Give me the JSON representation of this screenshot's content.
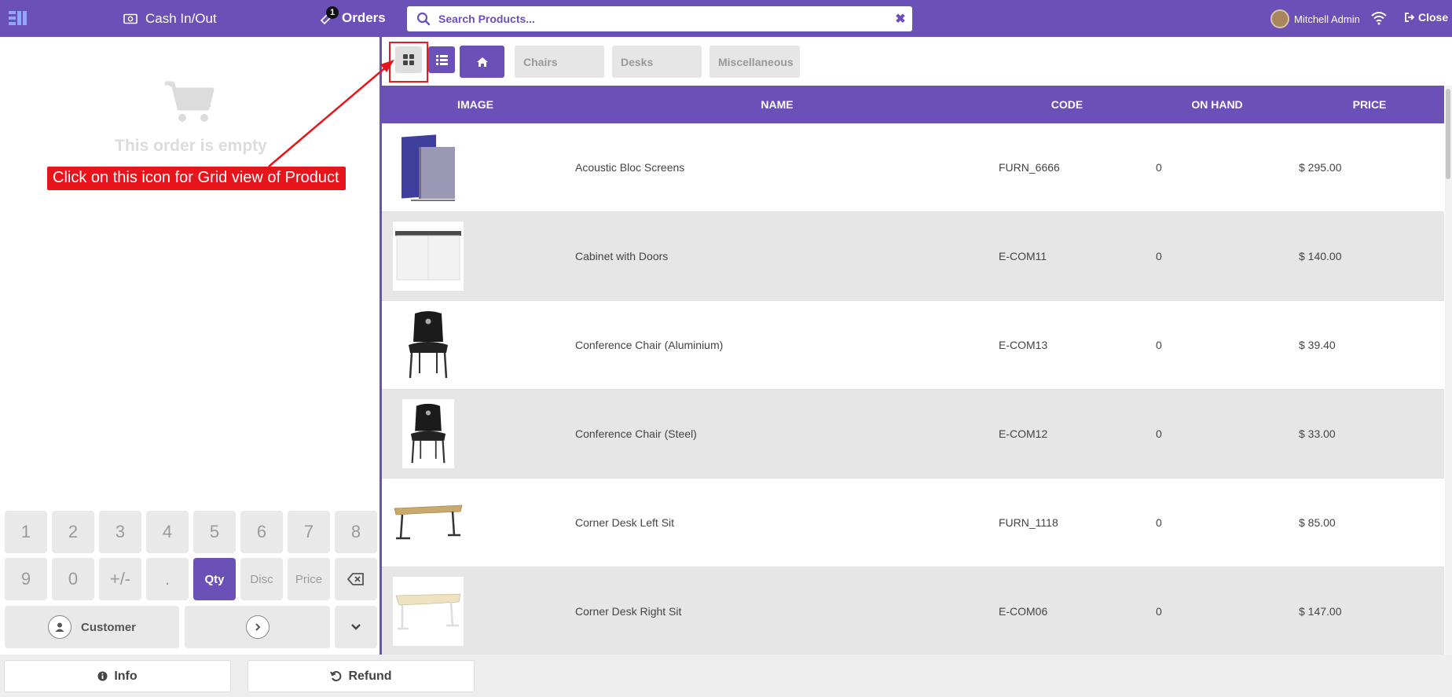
{
  "topbar": {
    "cash_label": "Cash In/Out",
    "orders_label": "Orders",
    "orders_badge": "1",
    "search_placeholder": "Search Products...",
    "user_name": "Mitchell Admin",
    "close_label": "Close",
    "brand_color": "#6b50b8"
  },
  "order": {
    "empty_text": "This order is empty"
  },
  "numpad": {
    "keys": [
      "1",
      "2",
      "3",
      "4",
      "5",
      "6",
      "7",
      "8",
      "9",
      "0",
      "+/-",
      ".",
      "Qty",
      "Disc",
      "Price",
      "backspace-icon"
    ],
    "active_key": "Qty",
    "customer_label": "Customer"
  },
  "bottombar": {
    "info_label": "Info",
    "refund_label": "Refund"
  },
  "categories": [
    "Chairs",
    "Desks",
    "Miscellaneous"
  ],
  "table": {
    "headers": [
      "IMAGE",
      "NAME",
      "CODE",
      "ON HAND",
      "PRICE"
    ],
    "rows": [
      {
        "name": "Acoustic Bloc Screens",
        "code": "FURN_6666",
        "on_hand": "0",
        "price": "$ 295.00",
        "image": "acoustic-screens"
      },
      {
        "name": "Cabinet with Doors",
        "code": "E-COM11",
        "on_hand": "0",
        "price": "$ 140.00",
        "image": "cabinet"
      },
      {
        "name": "Conference Chair (Aluminium)",
        "code": "E-COM13",
        "on_hand": "0",
        "price": "$ 39.40",
        "image": "chair"
      },
      {
        "name": "Conference Chair (Steel)",
        "code": "E-COM12",
        "on_hand": "0",
        "price": "$ 33.00",
        "image": "chair"
      },
      {
        "name": "Corner Desk Left Sit",
        "code": "FURN_1118",
        "on_hand": "0",
        "price": "$ 85.00",
        "image": "desk-dark"
      },
      {
        "name": "Corner Desk Right Sit",
        "code": "E-COM06",
        "on_hand": "0",
        "price": "$ 147.00",
        "image": "desk-light"
      }
    ]
  },
  "annotation": {
    "text": "Click on this icon for Grid view of Product",
    "color": "#e8141c"
  }
}
